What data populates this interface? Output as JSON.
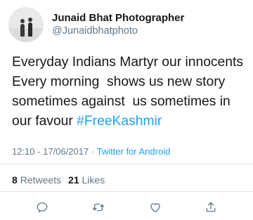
{
  "user": {
    "display_name": "Junaid Bhat Photographer",
    "handle": "@Junaidbhatphoto"
  },
  "tweet": {
    "lines": [
      "Everyday Indians Martyr our innocents",
      "Every morning  shows us new story",
      "sometimes against  us sometimes in",
      "our favour "
    ],
    "hashtag": "#FreeKashmir"
  },
  "meta": {
    "time": "12:10",
    "date": "17/06/2017",
    "separator": "·",
    "source": "Twitter for Android"
  },
  "stats": {
    "retweets_count": "8",
    "retweets_label": "Retweets",
    "likes_count": "21",
    "likes_label": "Likes"
  },
  "actions": {
    "reply_icon": "reply-icon",
    "retweet_icon": "retweet-icon",
    "like_icon": "heart-icon",
    "share_icon": "share-icon"
  },
  "colors": {
    "link": "#1da1f2",
    "secondary_text": "#657786",
    "primary_text": "#14171a",
    "divider": "#e1e8ed"
  }
}
